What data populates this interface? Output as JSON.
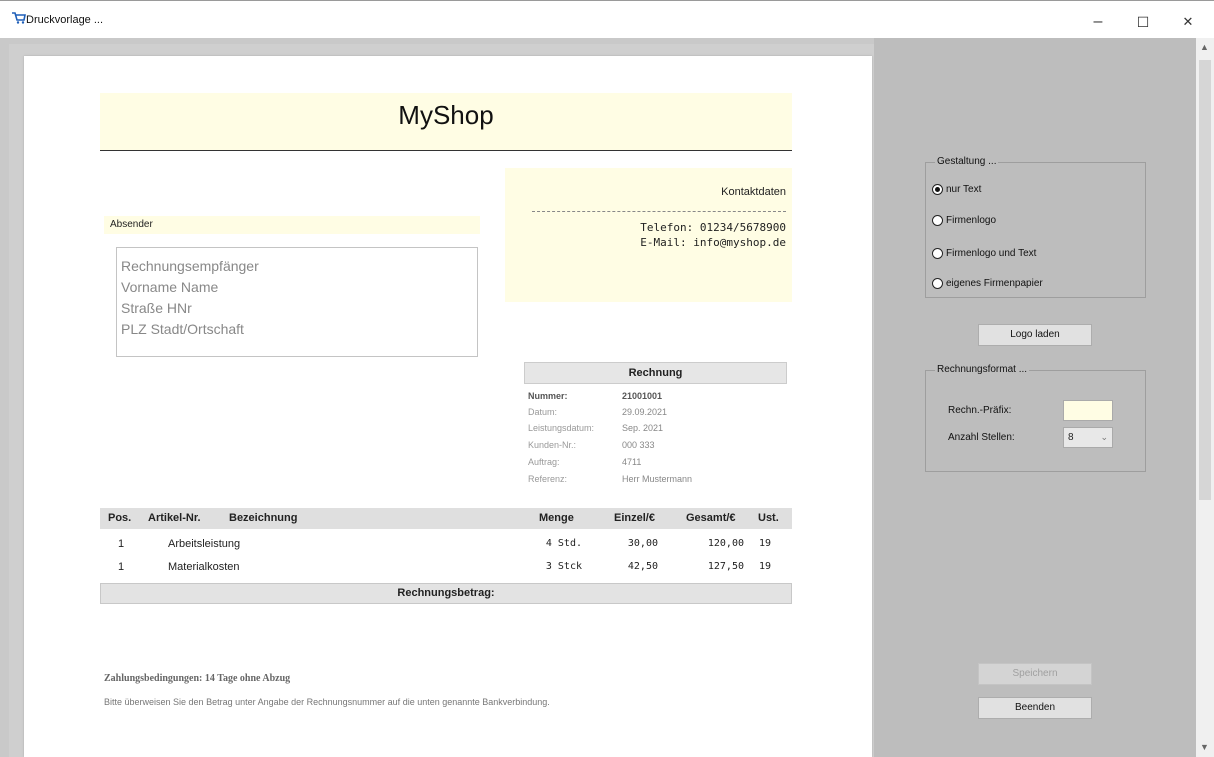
{
  "window": {
    "title": "Druckvorlage ...",
    "minimize": "–",
    "maximize": "☐",
    "close": "✕"
  },
  "invoice": {
    "shop_name": "MyShop",
    "contact_title": "Kontaktdaten",
    "phone": "Telefon: 01234/5678900",
    "email": "E-Mail: info@myshop.de",
    "sender_label": "Absender",
    "recipient": [
      "Rechnungsempfänger",
      "Vorname Name",
      "Straße HNr",
      "PLZ Stadt/Ortschaft"
    ],
    "invoice_heading": "Rechnung",
    "details": [
      {
        "label": "Nummer:",
        "value": "21001001"
      },
      {
        "label": "Datum:",
        "value": "29.09.2021"
      },
      {
        "label": "Leistungsdatum:",
        "value": "Sep. 2021"
      },
      {
        "label": "Kunden-Nr.:",
        "value": "000 333"
      },
      {
        "label": "Auftrag:",
        "value": "4711"
      },
      {
        "label": "Referenz:",
        "value": "Herr Mustermann"
      }
    ],
    "columns": {
      "pos": "Pos.",
      "article": "Artikel-Nr.",
      "description": "Bezeichnung",
      "quantity": "Menge",
      "unit_price": "Einzel/€",
      "total": "Gesamt/€",
      "vat": "Ust."
    },
    "items": [
      {
        "pos": "1",
        "description": "Arbeitsleistung",
        "quantity": "4 Std.",
        "unit_price": "30,00",
        "total": "120,00",
        "vat": "19"
      },
      {
        "pos": "1",
        "description": "Materialkosten",
        "quantity": "3 Stck",
        "unit_price": "42,50",
        "total": "127,50",
        "vat": "19"
      }
    ],
    "total_label": "Rechnungsbetrag:",
    "payment_terms": "Zahlungsbedingungen: 14 Tage ohne Abzug",
    "payment_note": "Bitte überweisen Sie den Betrag unter Angabe der Rechnungsnummer auf die unten genannte Bankverbindung."
  },
  "panel": {
    "design_group": "Gestaltung ...",
    "options": [
      {
        "label": "nur Text",
        "checked": true
      },
      {
        "label": "Firmenlogo",
        "checked": false
      },
      {
        "label": "Firmenlogo und Text",
        "checked": false
      },
      {
        "label": "eigenes Firmenpapier",
        "checked": false
      }
    ],
    "load_logo": "Logo laden",
    "format_group": "Rechnungsformat ...",
    "prefix_label": "Rechn.-Präfix:",
    "prefix_value": "",
    "digits_label": "Anzahl Stellen:",
    "digits_value": "8",
    "save": "Speichern",
    "quit": "Beenden"
  }
}
